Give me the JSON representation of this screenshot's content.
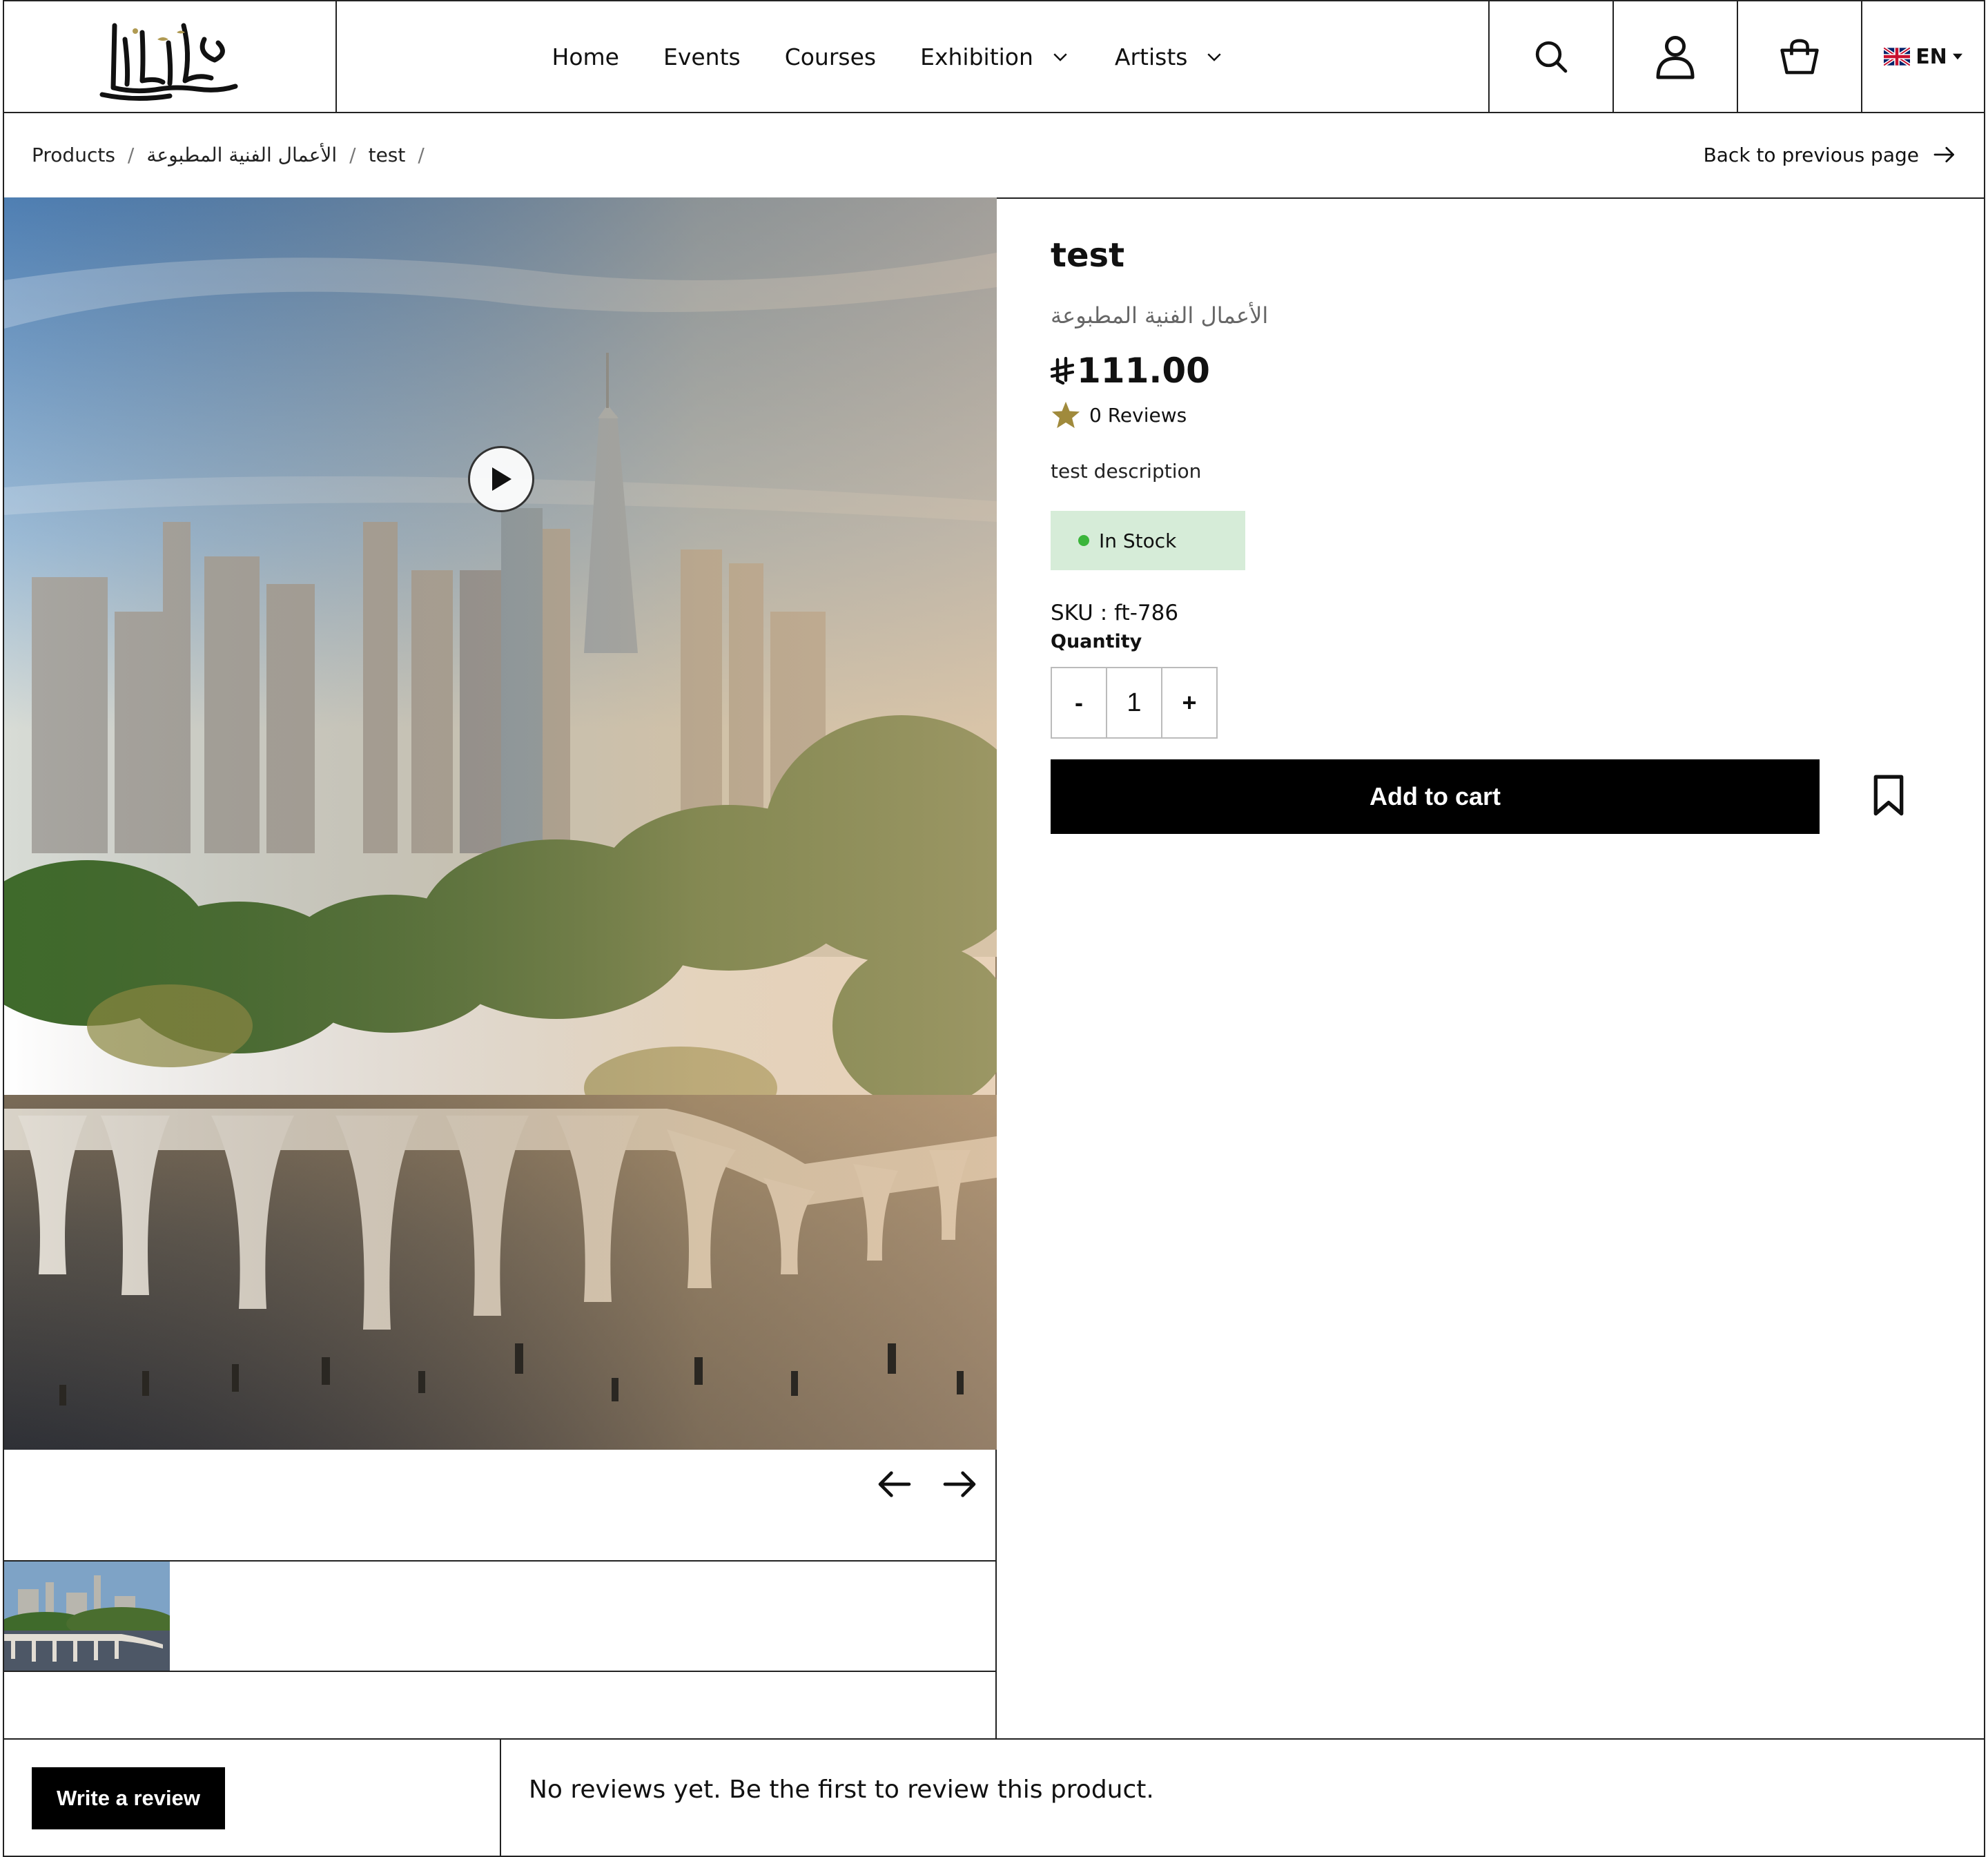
{
  "brand": {
    "logo_text": "الخطط"
  },
  "nav": {
    "items": [
      {
        "label": "Home",
        "has_dropdown": false
      },
      {
        "label": "Events",
        "has_dropdown": false
      },
      {
        "label": "Courses",
        "has_dropdown": false
      },
      {
        "label": "Exhibition",
        "has_dropdown": true
      },
      {
        "label": "Artists",
        "has_dropdown": true
      }
    ],
    "icons": [
      "search-icon",
      "user-icon",
      "shopping-bag-icon"
    ],
    "language": "EN"
  },
  "breadcrumb": {
    "items": [
      "Products",
      "الأعمال الفنية المطبوعة",
      "test"
    ],
    "back_label": "Back to previous page"
  },
  "product": {
    "title": "test",
    "category": "الأعمال الفنية المطبوعة",
    "currency_symbol": "⃁",
    "price": "111.00",
    "reviews_label": "0 Reviews",
    "description": "test description",
    "stock_status": "In Stock",
    "sku_label": "SKU :",
    "sku_value": "ft-786",
    "quantity_label": "Quantity",
    "quantity": "1",
    "decrement_label": "-",
    "increment_label": "+",
    "add_to_cart_label": "Add to cart"
  },
  "reviews": {
    "write_review_label": "Write a review",
    "empty_message": "No reviews yet. Be the first to review this product."
  },
  "colors": {
    "stock_bg": "#d6ecd8",
    "stock_dot": "#3bb53b",
    "star": "#a08a3c",
    "primary_button": "#000000"
  }
}
